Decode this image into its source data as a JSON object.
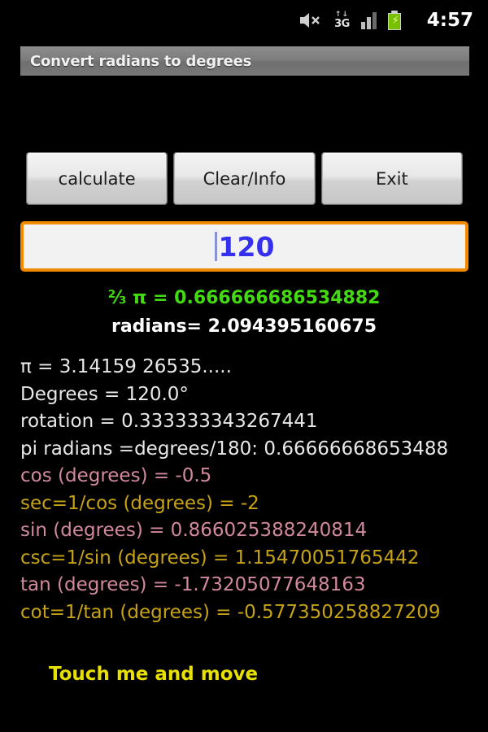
{
  "status_bar": {
    "mute_icon": "speaker-mute-icon",
    "network": {
      "arrows": "↑↓",
      "label": "3G"
    },
    "signal_icon": "signal-bars-icon",
    "battery_icon": "battery-charging-icon",
    "clock": "4:57"
  },
  "title_bar": {
    "title": "Convert radians to degrees"
  },
  "buttons": [
    {
      "id": "calculate",
      "label": "calculate"
    },
    {
      "id": "clear-info",
      "label": "Clear/Info"
    },
    {
      "id": "exit",
      "label": "Exit"
    }
  ],
  "input": {
    "value": "120",
    "placeholder": ""
  },
  "results": {
    "pi_fraction": "⅔ π = 0.666666686534882",
    "radians": "radians=  2.094395160675"
  },
  "details": [
    {
      "text": "π = 3.14159 26535.....",
      "color_class": ""
    },
    {
      "text": "Degrees = 120.0°",
      "color_class": ""
    },
    {
      "text": "rotation =  0.333333343267441",
      "color_class": ""
    },
    {
      "text": "pi radians =degrees/180:   0.66666668653488",
      "color_class": ""
    },
    {
      "text": "cos (degrees) = -0.5",
      "color_class": "pink"
    },
    {
      "text": "sec=1/cos (degrees) = -2",
      "color_class": "gold"
    },
    {
      "text": "sin (degrees) = 0.866025388240814",
      "color_class": "pink"
    },
    {
      "text": "csc=1/sin (degrees) = 1.15470051765442",
      "color_class": "gold"
    },
    {
      "text": "tan (degrees) = -1.73205077648163",
      "color_class": "pink"
    },
    {
      "text": "cot=1/tan (degrees) = -0.577350258827209",
      "color_class": "gold"
    }
  ],
  "touch_hint": "Touch me and move",
  "colors": {
    "accent_green": "#43da12",
    "accent_pink": "#d2899e",
    "accent_gold": "#c6a217",
    "accent_yellow": "#e8e000",
    "input_border": "#f08a00",
    "input_text": "#3430ee",
    "background": "#000000"
  }
}
